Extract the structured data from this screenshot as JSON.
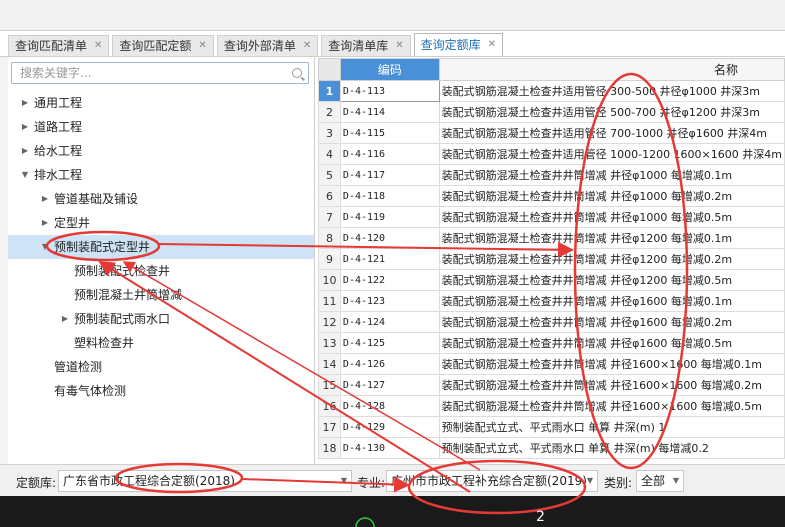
{
  "tabs": [
    {
      "label": "查询匹配清单",
      "active": false
    },
    {
      "label": "查询匹配定额",
      "active": false
    },
    {
      "label": "查询外部清单",
      "active": false
    },
    {
      "label": "查询清单库",
      "active": false
    },
    {
      "label": "查询定额库",
      "active": true
    }
  ],
  "search": {
    "placeholder": "搜索关键字..."
  },
  "tree": [
    {
      "label": "通用工程",
      "level": 0,
      "arrow": "collapsed"
    },
    {
      "label": "道路工程",
      "level": 0,
      "arrow": "collapsed"
    },
    {
      "label": "给水工程",
      "level": 0,
      "arrow": "collapsed"
    },
    {
      "label": "排水工程",
      "level": 0,
      "arrow": "expanded"
    },
    {
      "label": "管道基础及铺设",
      "level": 1,
      "arrow": "collapsed"
    },
    {
      "label": "定型井",
      "level": 1,
      "arrow": "collapsed"
    },
    {
      "label": "预制装配式定型井",
      "level": 1,
      "arrow": "expanded",
      "selected": true
    },
    {
      "label": "预制装配式检查井",
      "level": 2,
      "arrow": "none"
    },
    {
      "label": "预制混凝土井筒增减",
      "level": 2,
      "arrow": "none"
    },
    {
      "label": "预制装配式雨水口",
      "level": 2,
      "arrow": "collapsed"
    },
    {
      "label": "塑料检查井",
      "level": 2,
      "arrow": "none"
    },
    {
      "label": "管道检测",
      "level": 1,
      "arrow": "none"
    },
    {
      "label": "有毒气体检测",
      "level": 1,
      "arrow": "none"
    }
  ],
  "grid": {
    "headers": {
      "code": "编码",
      "name": "名称"
    },
    "rows": [
      {
        "no": "1",
        "code": "D-4-113",
        "name": "装配式钢筋混凝土检查井适用管径 300-500 井径φ1000 井深3m"
      },
      {
        "no": "2",
        "code": "D-4-114",
        "name": "装配式钢筋混凝土检查井适用管径 500-700 井径φ1200 井深3m"
      },
      {
        "no": "3",
        "code": "D-4-115",
        "name": "装配式钢筋混凝土检查井适用管径 700-1000 井径φ1600 井深4m"
      },
      {
        "no": "4",
        "code": "D-4-116",
        "name": "装配式钢筋混凝土检查井适用管径 1000-1200 1600×1600 井深4m"
      },
      {
        "no": "5",
        "code": "D-4-117",
        "name": "装配式钢筋混凝土检查井井筒增减 井径φ1000 每增减0.1m"
      },
      {
        "no": "6",
        "code": "D-4-118",
        "name": "装配式钢筋混凝土检查井井筒增减 井径φ1000 每增减0.2m"
      },
      {
        "no": "7",
        "code": "D-4-119",
        "name": "装配式钢筋混凝土检查井井筒增减 井径φ1000 每增减0.5m"
      },
      {
        "no": "8",
        "code": "D-4-120",
        "name": "装配式钢筋混凝土检查井井筒增减 井径φ1200 每增减0.1m"
      },
      {
        "no": "9",
        "code": "D-4-121",
        "name": "装配式钢筋混凝土检查井井筒增减 井径φ1200 每增减0.2m"
      },
      {
        "no": "10",
        "code": "D-4-122",
        "name": "装配式钢筋混凝土检查井井筒增减 井径φ1200 每增减0.5m"
      },
      {
        "no": "11",
        "code": "D-4-123",
        "name": "装配式钢筋混凝土检查井井筒增减 井径φ1600 每增减0.1m"
      },
      {
        "no": "12",
        "code": "D-4-124",
        "name": "装配式钢筋混凝土检查井井筒增减 井径φ1600 每增减0.2m"
      },
      {
        "no": "13",
        "code": "D-4-125",
        "name": "装配式钢筋混凝土检查井井筒增减 井径φ1600 每增减0.5m"
      },
      {
        "no": "14",
        "code": "D-4-126",
        "name": "装配式钢筋混凝土检查井井筒增减 井径1600×1600 每增减0.1m"
      },
      {
        "no": "15",
        "code": "D-4-127",
        "name": "装配式钢筋混凝土检查井井筒增减 井径1600×1600 每增减0.2m"
      },
      {
        "no": "16",
        "code": "D-4-128",
        "name": "装配式钢筋混凝土检查井井筒增减 井径1600×1600 每增减0.5m"
      },
      {
        "no": "17",
        "code": "D-4-129",
        "name": "预制装配式立式、平式雨水口 单算 井深(m) 1"
      },
      {
        "no": "18",
        "code": "D-4-130",
        "name": "预制装配式立式、平式雨水口 单算 井深(m) 每增减0.2"
      }
    ]
  },
  "bottom": {
    "quota_label": "定额库:",
    "quota_value": "广东省市政工程综合定额(2018)",
    "major_label": "专业:",
    "major_value": "广州市市政工程补充综合定额(2019)",
    "category_label": "类别:",
    "category_value": "全部"
  },
  "annotation": {
    "number": "2"
  },
  "colors": {
    "accent": "#4a90d9",
    "active_tab_text": "#1f6fb5",
    "annotation": "#e53935"
  }
}
